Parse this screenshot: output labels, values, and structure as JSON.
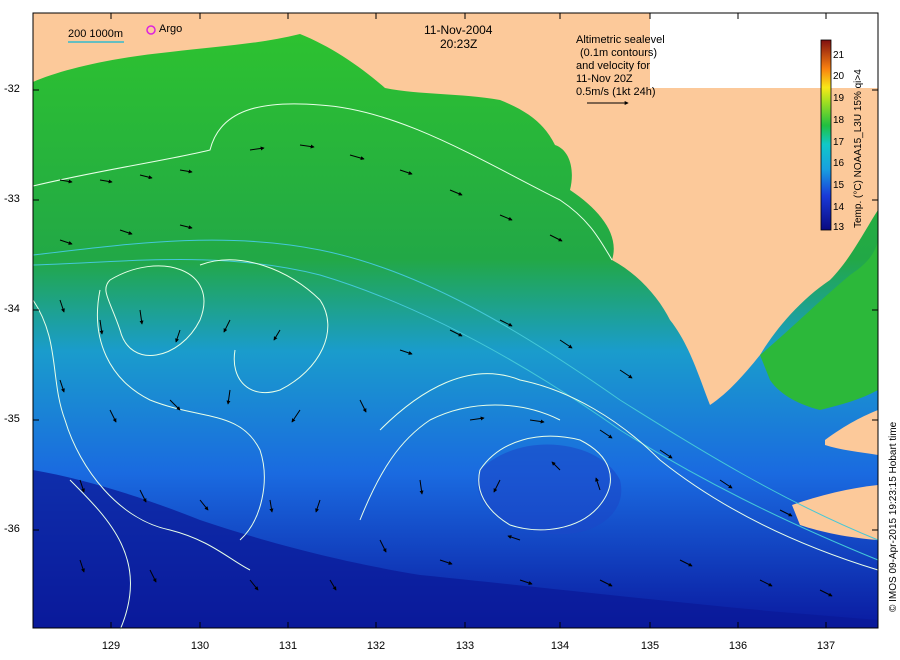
{
  "header": {
    "date": "11-Nov-2004",
    "time": "20:23Z"
  },
  "legend": {
    "isobaths": "200  1000m",
    "argo": "Argo",
    "description": [
      "Altimetric sealevel",
      "(0.1m contours)",
      "and velocity for",
      "11-Nov 20Z",
      "0.5m/s (1kt 24h)"
    ]
  },
  "axes": {
    "y_ticks": [
      "-32",
      "-33",
      "-34",
      "-35",
      "-36"
    ],
    "x_ticks": [
      "129",
      "130",
      "131",
      "132",
      "133",
      "134",
      "135",
      "136",
      "137"
    ]
  },
  "colorbar": {
    "title": "Temp. (°C) NOAA15_L3U 15% qi>4",
    "ticks": [
      "21",
      "20",
      "19",
      "18",
      "17",
      "16",
      "15",
      "14",
      "13"
    ],
    "min": 13,
    "max": 21
  },
  "credit": "© IMOS 09-Apr-2015 19:23:15 Hobart time",
  "colors": {
    "land": "#fcc99a",
    "frame": "#000000",
    "contour": "#e8ffe8",
    "argo": "#dd22dd",
    "isobath": "#33bbcc"
  }
}
